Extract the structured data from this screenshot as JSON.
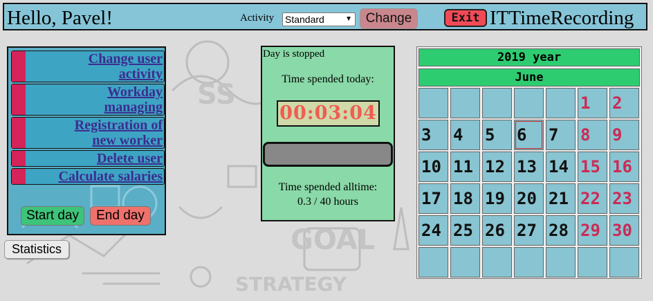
{
  "header": {
    "greeting": "Hello, Pavel!",
    "activity_label": "Activity",
    "activity_selected": "Standard",
    "change_label": "Change",
    "exit_label": "Exit",
    "app_title": "ITTimeRecording"
  },
  "menu": {
    "items": [
      {
        "label_lines": [
          "Change user",
          "activity"
        ]
      },
      {
        "label_lines": [
          "Workday",
          "managing"
        ]
      },
      {
        "label_lines": [
          "Registration of",
          "new worker"
        ]
      },
      {
        "label_lines": [
          "Delete user"
        ]
      },
      {
        "label_lines": [
          "Calculate salaries"
        ]
      }
    ],
    "start_label": "Start day",
    "end_label": "End day",
    "statistics_label": "Statistics"
  },
  "timer": {
    "status": "Day is stopped",
    "today_label": "Time spended today:",
    "today_value": "00:03:04",
    "progress_fraction": 0,
    "alltime_label": "Time spended alltime:",
    "alltime_value": "0.3 / 40 hours"
  },
  "calendar": {
    "year_label": "2019 year",
    "month_label": "June",
    "today_day": 6,
    "weeks": [
      [
        null,
        null,
        null,
        null,
        null,
        {
          "d": 1,
          "w": true
        },
        {
          "d": 2,
          "w": true
        }
      ],
      [
        {
          "d": 3
        },
        {
          "d": 4
        },
        {
          "d": 5
        },
        {
          "d": 6
        },
        {
          "d": 7
        },
        {
          "d": 8,
          "w": true
        },
        {
          "d": 9,
          "w": true
        }
      ],
      [
        {
          "d": 10
        },
        {
          "d": 11
        },
        {
          "d": 12
        },
        {
          "d": 13
        },
        {
          "d": 14
        },
        {
          "d": 15,
          "w": true
        },
        {
          "d": 16,
          "w": true
        }
      ],
      [
        {
          "d": 17
        },
        {
          "d": 18
        },
        {
          "d": 19
        },
        {
          "d": 20
        },
        {
          "d": 21
        },
        {
          "d": 22,
          "w": true
        },
        {
          "d": 23,
          "w": true
        }
      ],
      [
        {
          "d": 24
        },
        {
          "d": 25
        },
        {
          "d": 26
        },
        {
          "d": 27
        },
        {
          "d": 28
        },
        {
          "d": 29,
          "w": true
        },
        {
          "d": 30,
          "w": true
        }
      ],
      [
        null,
        null,
        null,
        null,
        null,
        null,
        null
      ]
    ]
  },
  "colors": {
    "header_bg": "#86c5d8",
    "menu_marker": "#d4245a",
    "weekend_text": "#cc2a55",
    "calendar_header": "#2ecc71",
    "timer_text": "#ef5d52"
  }
}
